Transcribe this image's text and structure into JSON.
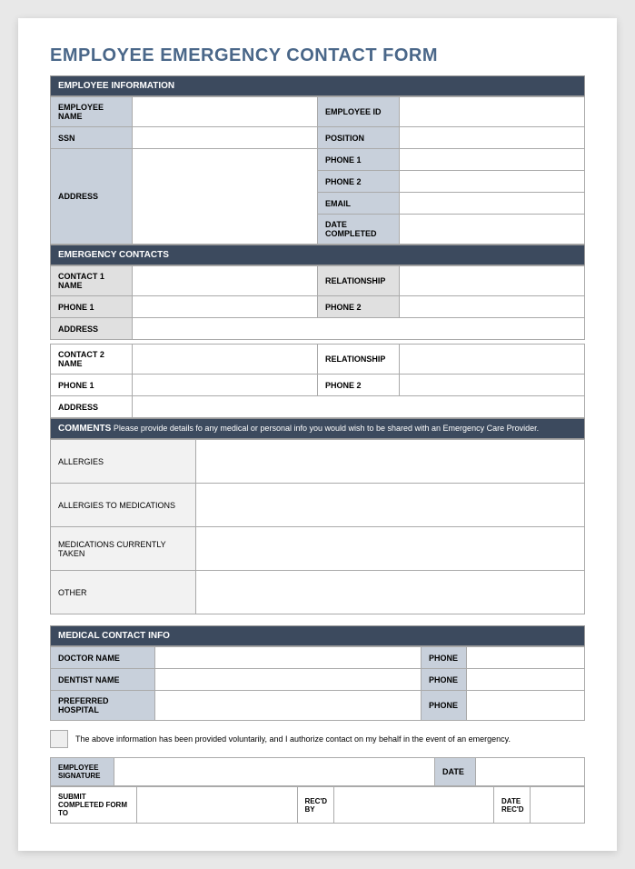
{
  "title": "EMPLOYEE EMERGENCY CONTACT FORM",
  "sections": {
    "employeeInfo": {
      "header": "EMPLOYEE INFORMATION",
      "labels": {
        "employeeName": "EMPLOYEE NAME",
        "employeeId": "EMPLOYEE ID",
        "ssn": "SSN",
        "position": "POSITION",
        "address": "ADDRESS",
        "phone1": "PHONE 1",
        "phone2": "PHONE 2",
        "email": "EMAIL",
        "dateCompleted": "DATE COMPLETED"
      }
    },
    "emergencyContacts": {
      "header": "EMERGENCY CONTACTS",
      "labels": {
        "contact1Name": "CONTACT 1 NAME",
        "contact2Name": "CONTACT 2 NAME",
        "relationship": "RELATIONSHIP",
        "phone1": "PHONE 1",
        "phone2": "PHONE 2",
        "address": "ADDRESS"
      }
    },
    "comments": {
      "headerBold": "COMMENTS",
      "headerText": " Please provide details fo any medical or personal info you would wish to be shared with an Emergency Care Provider.",
      "labels": {
        "allergies": "ALLERGIES",
        "allergiesToMeds": "ALLERGIES TO MEDICATIONS",
        "medsCurrentlyTaken": "MEDICATIONS CURRENTLY TAKEN",
        "other": "OTHER"
      }
    },
    "medicalContact": {
      "header": "MEDICAL CONTACT INFO",
      "labels": {
        "doctorName": "DOCTOR NAME",
        "dentistName": "DENTIST NAME",
        "preferredHospital": "PREFERRED HOSPITAL",
        "phone": "PHONE"
      }
    },
    "authorization": {
      "text": "The above information has been provided voluntarily, and I authorize contact on my behalf in the event of an emergency."
    },
    "signature": {
      "labels": {
        "employeeSignature": "EMPLOYEE SIGNATURE",
        "date": "DATE",
        "submitTo": "SUBMIT COMPLETED FORM TO",
        "recdBy": "REC'D BY",
        "dateRecd": "DATE REC'D"
      }
    }
  }
}
